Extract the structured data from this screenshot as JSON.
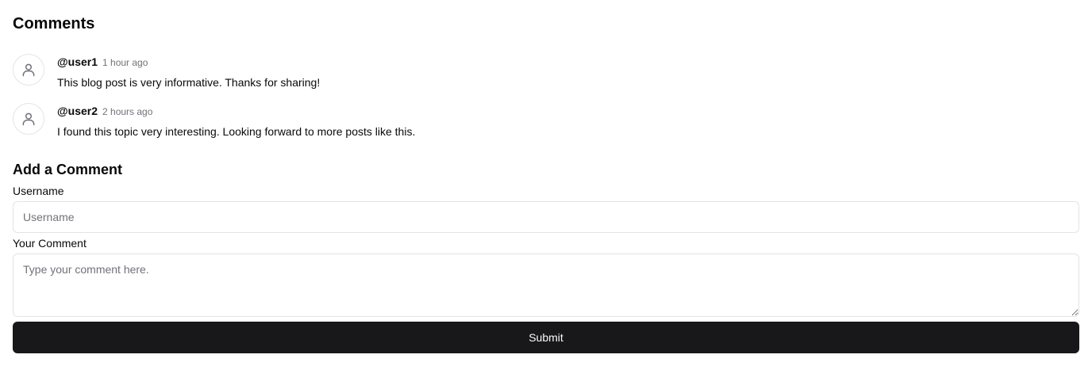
{
  "comments_section": {
    "title": "Comments",
    "items": [
      {
        "username": "@user1",
        "time": "1 hour ago",
        "text": "This blog post is very informative. Thanks for sharing!",
        "avatar_icon": "user-icon"
      },
      {
        "username": "@user2",
        "time": "2 hours ago",
        "text": "I found this topic very interesting. Looking forward to more posts like this.",
        "avatar_icon": "user-icon"
      }
    ]
  },
  "form": {
    "title": "Add a Comment",
    "username_label": "Username",
    "username_placeholder": "Username",
    "username_value": "",
    "comment_label": "Your Comment",
    "comment_placeholder": "Type your comment here.",
    "comment_value": "",
    "submit_label": "Submit"
  },
  "colors": {
    "primary": "#18181b",
    "primary_text": "#fafafa",
    "muted_text": "#71717a",
    "border": "#e4e4e7",
    "avatar_icon": "#71717a"
  }
}
